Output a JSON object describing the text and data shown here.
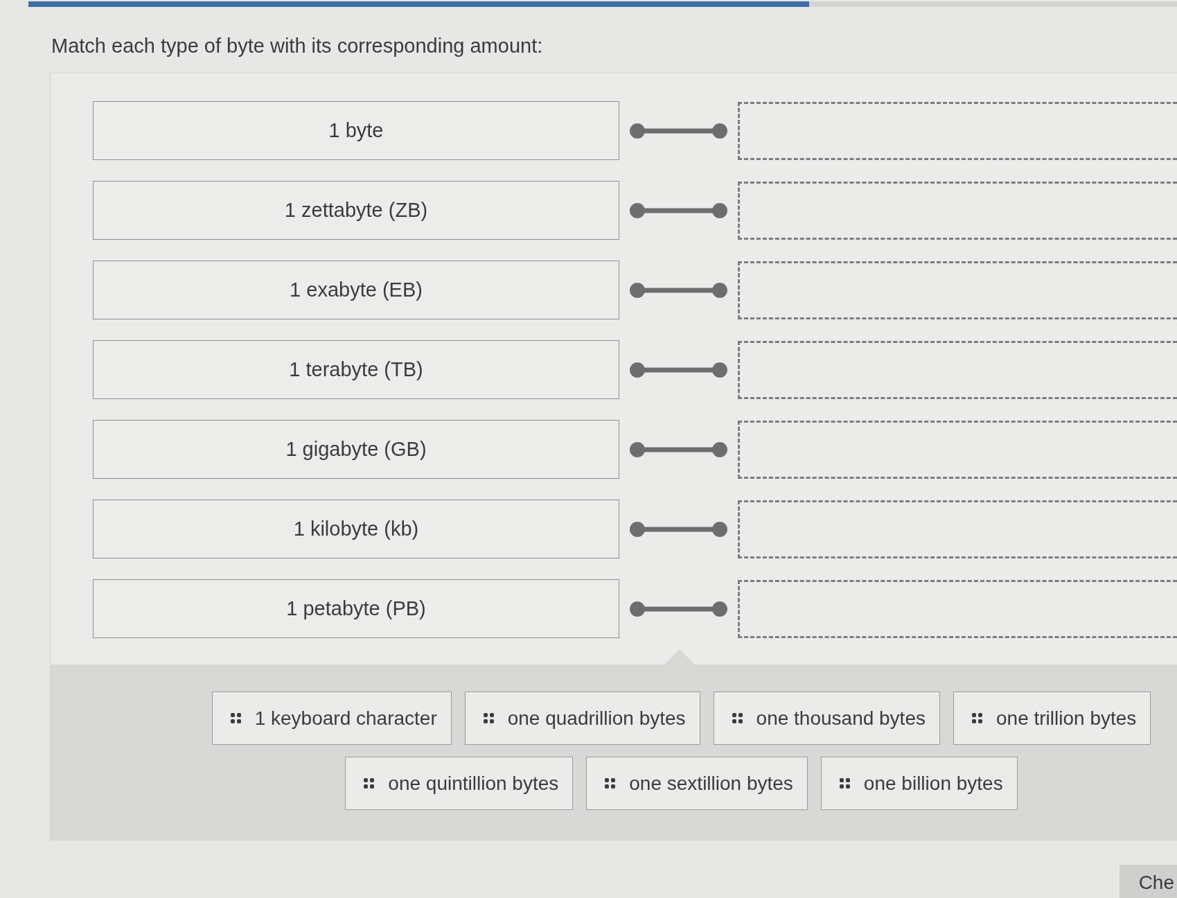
{
  "progress": {
    "level": 0.68
  },
  "prompt": "Match each type of byte with its corresponding amount:",
  "rows": [
    {
      "term": "1 byte"
    },
    {
      "term": "1 zettabyte (ZB)"
    },
    {
      "term": "1 exabyte (EB)"
    },
    {
      "term": "1 terabyte (TB)"
    },
    {
      "term": "1 gigabyte (GB)"
    },
    {
      "term": "1 kilobyte (kb)"
    },
    {
      "term": "1 petabyte (PB)"
    }
  ],
  "answer_bank": [
    {
      "label": "1 keyboard character"
    },
    {
      "label": "one quadrillion bytes"
    },
    {
      "label": "one thousand bytes"
    },
    {
      "label": "one trillion bytes"
    },
    {
      "label": "one quintillion bytes"
    },
    {
      "label": "one sextillion bytes"
    },
    {
      "label": "one billion bytes"
    }
  ],
  "button": {
    "label": "Che"
  }
}
